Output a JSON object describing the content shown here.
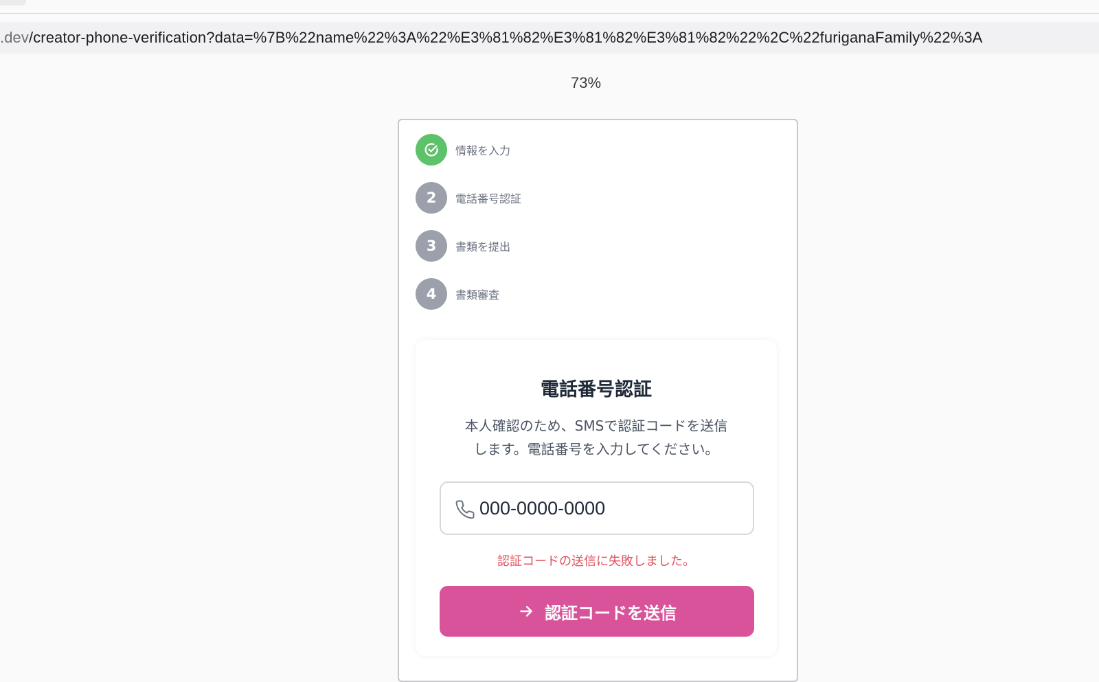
{
  "browser": {
    "url_domain": ".dev",
    "url_path": "/creator-phone-verification?data=%7B%22name%22%3A%22%E3%81%82%E3%81%82%E3%81%82%22%2C%22furiganaFamily%22%3A"
  },
  "zoom": "73%",
  "steps": [
    {
      "number": "",
      "label": "情報を入力",
      "status": "completed",
      "icon": "check-circle-icon"
    },
    {
      "number": "2",
      "label": "電話番号認証",
      "status": "pending"
    },
    {
      "number": "3",
      "label": "書類を提出",
      "status": "pending"
    },
    {
      "number": "4",
      "label": "書類審査",
      "status": "pending"
    }
  ],
  "card": {
    "title": "電話番号認証",
    "description_line1": "本人確認のため、SMSで認証コードを送信",
    "description_line2": "します。電話番号を入力してください。",
    "phone_placeholder": "000-0000-0000",
    "error_message": "認証コードの送信に失敗しました。",
    "submit_label": "認証コードを送信",
    "submit_icon": "arrow-right-icon",
    "phone_icon": "phone-icon"
  },
  "colors": {
    "accent": "#d9539a",
    "completed": "#5ec26a",
    "pending": "#9ca0aa",
    "error": "#e0525d"
  }
}
